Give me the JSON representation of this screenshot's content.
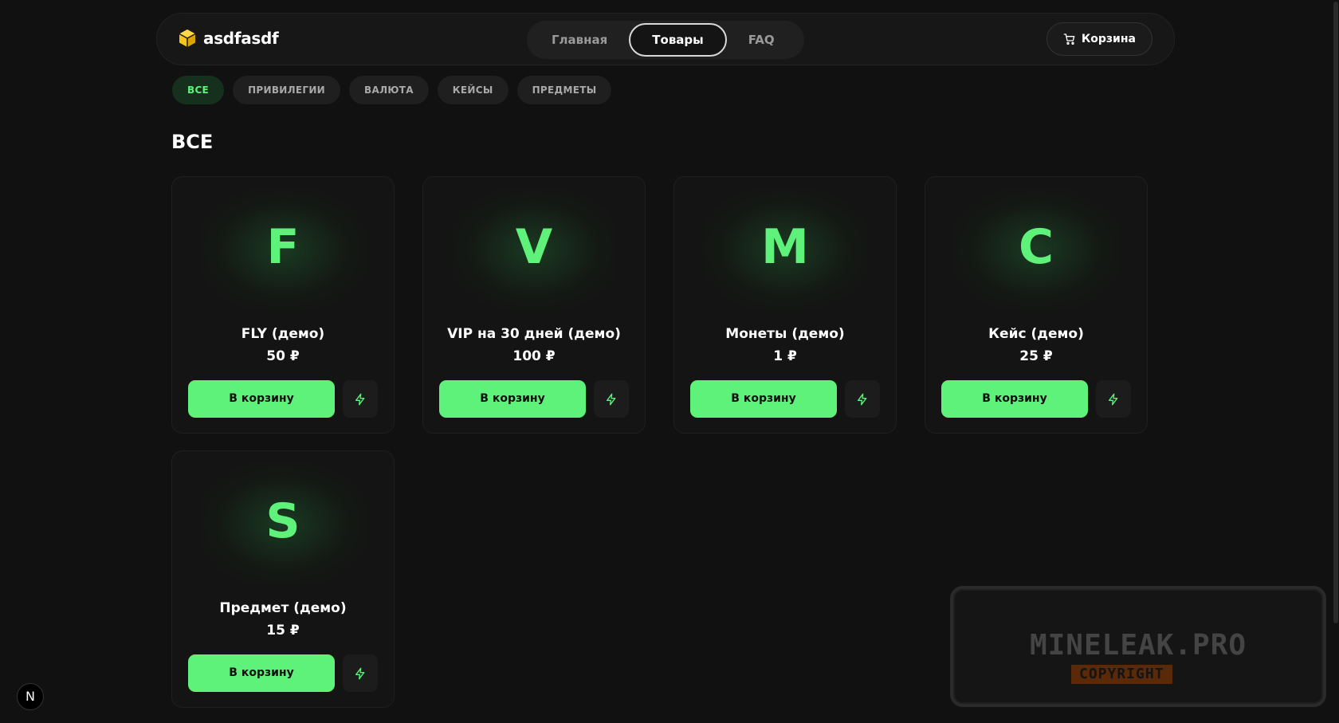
{
  "header": {
    "logo_text": "asdfasdf",
    "logo_icon": "cube-logo-icon",
    "nav": [
      "Главная",
      "Товары",
      "FAQ"
    ],
    "nav_active": "Товары",
    "cart_label": "Корзина",
    "cart_icon": "cart-icon"
  },
  "filters": [
    "ВСЕ",
    "ПРИВИЛЕГИИ",
    "ВАЛЮТА",
    "КЕЙСЫ",
    "ПРЕДМЕТЫ"
  ],
  "filter_active": "ВСЕ",
  "section_title": "ВСЕ",
  "products": [
    {
      "letter": "F",
      "name": "FLY (демо)",
      "price": "50 ₽",
      "button": "В корзину"
    },
    {
      "letter": "V",
      "name": "VIP на 30 дней (демо)",
      "price": "100 ₽",
      "button": "В корзину"
    },
    {
      "letter": "M",
      "name": "Монеты (демо)",
      "price": "1 ₽",
      "button": "В корзину"
    },
    {
      "letter": "C",
      "name": "Кейс (демо)",
      "price": "25 ₽",
      "button": "В корзину"
    },
    {
      "letter": "S",
      "name": "Предмет (демо)",
      "price": "15 ₽",
      "button": "В корзину"
    }
  ],
  "quick_buy_icon": "lightning-icon",
  "watermark": {
    "title": "MINELEAK.PRO",
    "subtitle": "COPYRIGHT"
  },
  "dev_badge": "N",
  "colors": {
    "accent": "#5ef27a",
    "background": "#111111",
    "card": "#141414"
  }
}
